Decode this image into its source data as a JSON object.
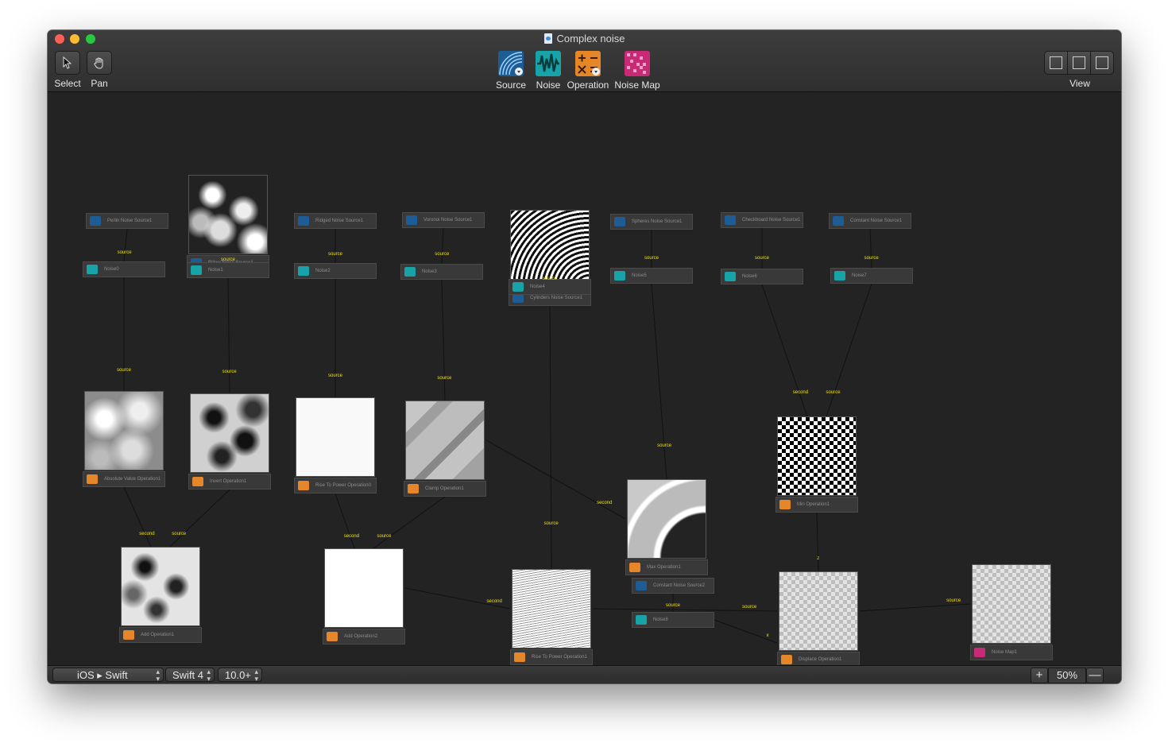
{
  "window": {
    "title": "Complex noise"
  },
  "toolbar": {
    "select_label": "Select",
    "pan_label": "Pan",
    "source_label": "Source",
    "noise_label": "Noise",
    "operation_label": "Operation",
    "noise_map_label": "Noise Map",
    "view_label": "View"
  },
  "colors": {
    "source": "#1d5c95",
    "noise": "#17a3a8",
    "operation": "#e58628",
    "noise_map": "#c82a76",
    "wire_label": "#f0e000"
  },
  "nodes": [
    {
      "id": "billow",
      "label": "Billow Noise Source1",
      "kind": "source"
    },
    {
      "id": "perlin",
      "label": "Perlin Noise Source1",
      "kind": "source"
    },
    {
      "id": "ridged",
      "label": "Ridged Noise Source1",
      "kind": "source"
    },
    {
      "id": "voronoi",
      "label": "Voronoi Noise Source1",
      "kind": "source"
    },
    {
      "id": "cylinders",
      "label": "Cylinders Noise Source1",
      "kind": "source"
    },
    {
      "id": "spheres",
      "label": "Spheres Noise Source1",
      "kind": "source"
    },
    {
      "id": "checkboard",
      "label": "Checkboard Noise Source1",
      "kind": "source"
    },
    {
      "id": "constant1",
      "label": "Constant Noise Source1",
      "kind": "source"
    },
    {
      "id": "noise0",
      "label": "Noise0",
      "kind": "noise"
    },
    {
      "id": "noise1",
      "label": "Noise1",
      "kind": "noise"
    },
    {
      "id": "noise2",
      "label": "Noise2",
      "kind": "noise"
    },
    {
      "id": "noise3",
      "label": "Noise3",
      "kind": "noise"
    },
    {
      "id": "noise4",
      "label": "Noise4",
      "kind": "noise"
    },
    {
      "id": "noise5",
      "label": "Noise5",
      "kind": "noise"
    },
    {
      "id": "noise6",
      "label": "Noise6",
      "kind": "noise"
    },
    {
      "id": "noise7",
      "label": "Noise7",
      "kind": "noise"
    },
    {
      "id": "absval",
      "label": "Absolute Value Operation1",
      "kind": "operation"
    },
    {
      "id": "invert",
      "label": "Invert Operation1",
      "kind": "operation"
    },
    {
      "id": "rtp0",
      "label": "Rise To Power Operation0",
      "kind": "operation"
    },
    {
      "id": "clamp",
      "label": "Clamp Operation1",
      "kind": "operation"
    },
    {
      "id": "max",
      "label": "Max Operation1",
      "kind": "operation"
    },
    {
      "id": "min",
      "label": "Min Operation1",
      "kind": "operation"
    },
    {
      "id": "add1",
      "label": "Add Operation1",
      "kind": "operation"
    },
    {
      "id": "add2",
      "label": "Add Operation2",
      "kind": "operation"
    },
    {
      "id": "rtp1",
      "label": "Rise To Power Operation1",
      "kind": "operation"
    },
    {
      "id": "displace",
      "label": "Displace Operation1",
      "kind": "operation"
    },
    {
      "id": "constant2",
      "label": "Constant Noise Source2",
      "kind": "source"
    },
    {
      "id": "noise8",
      "label": "Noise8",
      "kind": "noise"
    },
    {
      "id": "noisemap",
      "label": "Noise Map1",
      "kind": "noise_map"
    }
  ],
  "wire_labels": {
    "source": "source",
    "second": "second",
    "z": "z",
    "x": "x"
  },
  "status": {
    "platform": "iOS ▸ Swift",
    "swift_version": "Swift 4",
    "os_version": "10.0+",
    "zoom": "50%",
    "zoom_in": "+",
    "zoom_out": "—"
  }
}
